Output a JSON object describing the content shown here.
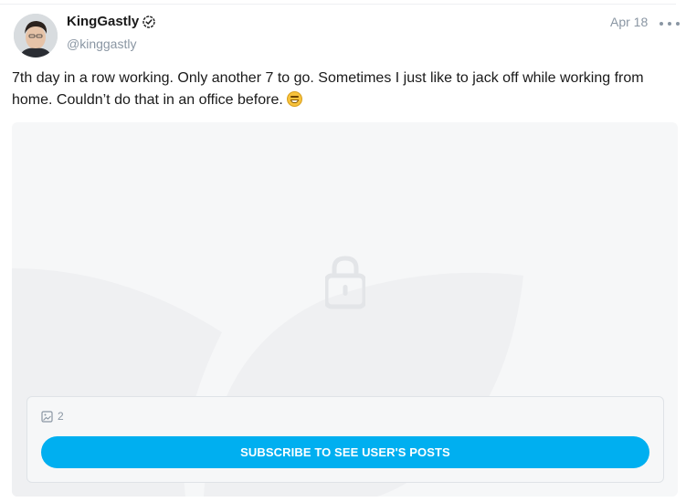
{
  "post": {
    "author_name": "KingGastly",
    "author_handle": "@kinggastly",
    "date": "Apr 18",
    "text": "7th day in a row working. Only another 7 to go. Sometimes I just like to jack off while working from home. Couldn’t do that in an office before.",
    "emoji": "grinning-face-with-sweat",
    "media_count": "2",
    "subscribe_label": "SUBSCRIBE TO SEE USER'S POSTS"
  },
  "icons": {
    "verified": "verified-check-icon",
    "more": "more-dots-icon",
    "lock": "lock-icon",
    "image": "image-icon"
  },
  "colors": {
    "accent": "#00aff0",
    "muted": "#8a96a3",
    "media_bg": "#f6f7f8"
  }
}
